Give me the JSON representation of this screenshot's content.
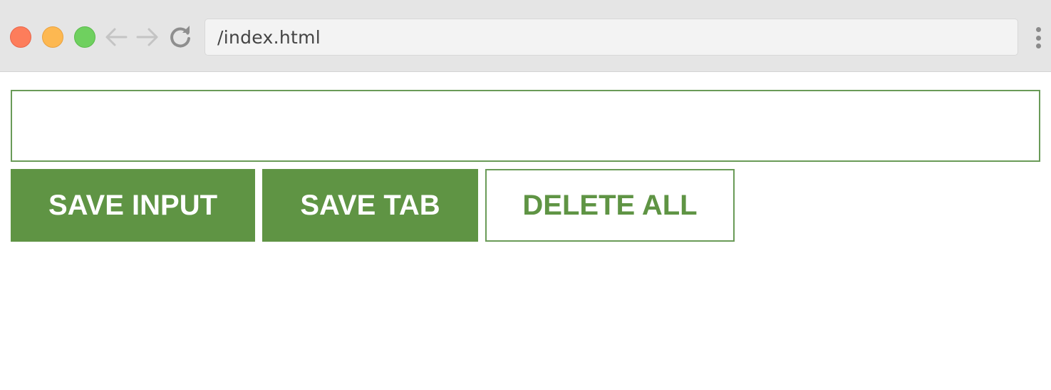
{
  "browser": {
    "url": "/index.html",
    "icons": {
      "close": "close-traffic-light",
      "minimize": "minimize-traffic-light",
      "maximize": "maximize-traffic-light",
      "back": "arrow-left-icon",
      "forward": "arrow-right-icon",
      "reload": "reload-icon",
      "menu": "kebab-menu-icon"
    },
    "colors": {
      "close": "#fd7d5b",
      "minimize": "#fdb851",
      "maximize": "#6fd05f",
      "chrome": "#e5e5e5"
    }
  },
  "main": {
    "input": {
      "value": "",
      "placeholder": ""
    },
    "buttons": {
      "save_input": "SAVE INPUT",
      "save_tab": "SAVE TAB",
      "delete_all": "DELETE ALL"
    },
    "colors": {
      "accent": "#5f9444",
      "border": "#6a9b58",
      "background": "#ffffff"
    }
  }
}
